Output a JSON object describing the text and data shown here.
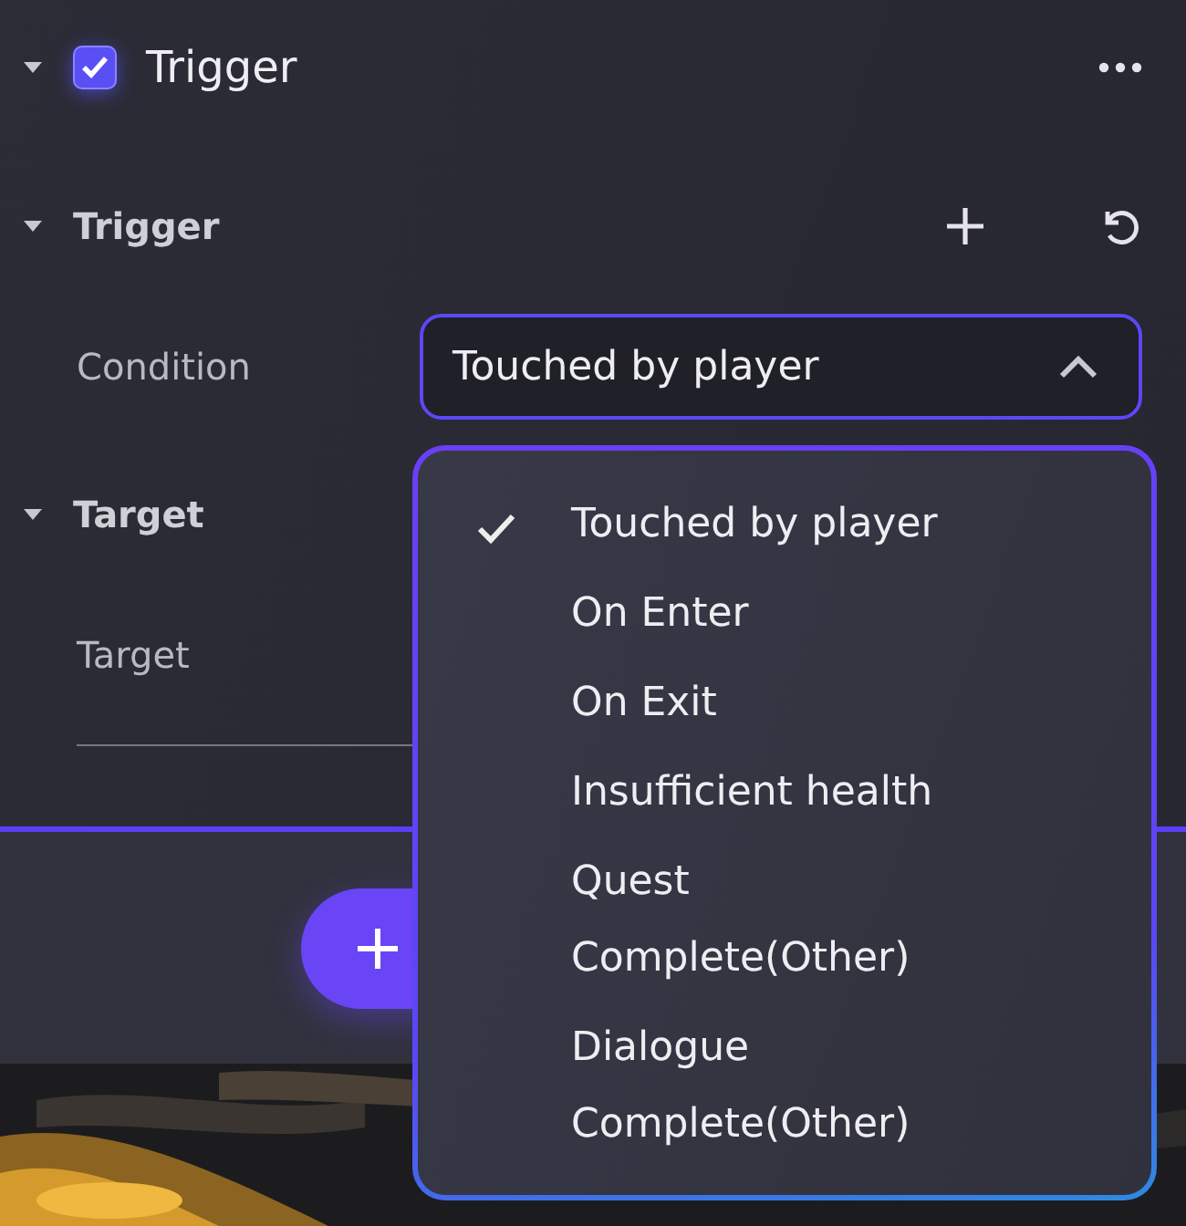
{
  "component": {
    "title": "Trigger",
    "enabled": true,
    "expanded": true
  },
  "sections": [
    {
      "title": "Trigger",
      "expanded": true,
      "can_add": true,
      "can_reset": true,
      "fields": [
        {
          "label": "Condition",
          "value": "Touched by player",
          "open": true
        }
      ]
    },
    {
      "title": "Target",
      "expanded": true,
      "can_add": false,
      "can_reset": false,
      "fields": [
        {
          "label": "Target"
        }
      ]
    }
  ],
  "dropdown": {
    "options": [
      {
        "label": "Touched by player",
        "selected": true
      },
      {
        "label": "On Enter",
        "selected": false
      },
      {
        "label": "On Exit",
        "selected": false
      },
      {
        "label": "Insufficient health",
        "selected": false
      },
      {
        "label": "Quest Complete(Other)",
        "selected": false
      },
      {
        "label": "Dialogue Complete(Other)",
        "selected": false
      }
    ]
  }
}
